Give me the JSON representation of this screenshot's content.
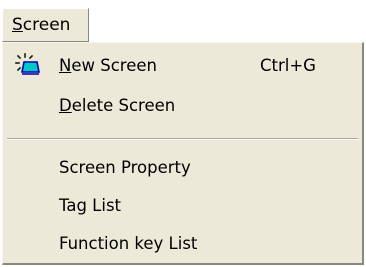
{
  "menubar": {
    "screen_menu": {
      "mnemonic": "S",
      "rest": "creen"
    }
  },
  "menu": {
    "items": [
      {
        "mnemonic": "N",
        "rest": "ew Screen",
        "shortcut": "Ctrl+G",
        "icon": "new-screen-icon"
      },
      {
        "mnemonic": "D",
        "rest": "elete Screen"
      },
      {
        "label": "Screen Property"
      },
      {
        "label": "Tag List"
      },
      {
        "label": "Function key List"
      }
    ]
  },
  "colors": {
    "menu_background": "#ece9d8",
    "icon_fill": "#00c8c8",
    "icon_outline": "#0000aa",
    "icon_rays": "#1a1a1a"
  }
}
